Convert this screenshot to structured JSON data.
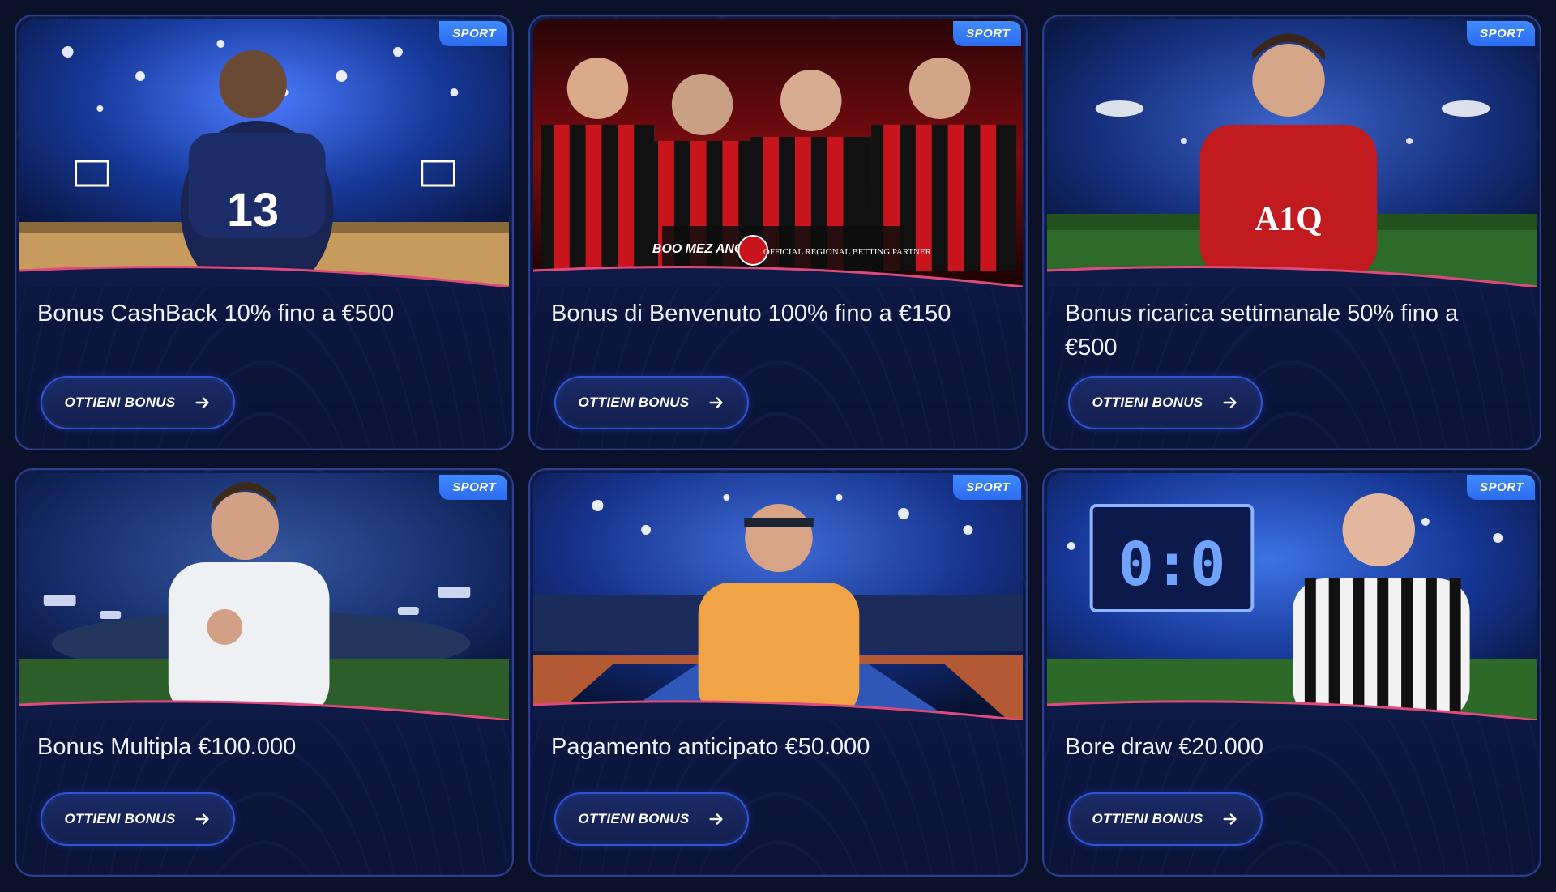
{
  "theme": {
    "accent": "#3f8bff",
    "background": "#0a1128",
    "card_background": "#0f1b47",
    "card_border": "#2b3f8f"
  },
  "cards": [
    {
      "badge": "SPORT",
      "title": "Bonus CashBack 10% fino a €500",
      "button_label": "OTTIENI BONUS",
      "button_icon": "arrow-right-icon",
      "image": "basketball-player-arena",
      "image_text": "13"
    },
    {
      "badge": "SPORT",
      "title": "Bonus di Benvenuto 100% fino a €150",
      "button_label": "OTTIENI BONUS",
      "button_icon": "arrow-right-icon",
      "image": "milan-players-partner",
      "image_text": "OFFICIAL REGIONAL BETTING PARTNER",
      "image_brand": "BOO MEZ ANG"
    },
    {
      "badge": "SPORT",
      "title": "Bonus ricarica settimanale 50% fino a €500",
      "button_label": "OTTIENI BONUS",
      "button_icon": "arrow-right-icon",
      "image": "footballer-red-shirt-stadium",
      "image_text": "A1Q"
    },
    {
      "badge": "SPORT",
      "title": "Bonus Multipla €100.000",
      "button_label": "OTTIENI BONUS",
      "button_icon": "arrow-right-icon",
      "image": "celebrating-player-stadium"
    },
    {
      "badge": "SPORT",
      "title": "Pagamento anticipato €50.000",
      "button_label": "OTTIENI BONUS",
      "button_icon": "arrow-right-icon",
      "image": "tennis-player-court"
    },
    {
      "badge": "SPORT",
      "title": "Bore draw €20.000",
      "button_label": "OTTIENI BONUS",
      "button_icon": "arrow-right-icon",
      "image": "referee-scoreboard",
      "image_text": "0:0"
    }
  ]
}
